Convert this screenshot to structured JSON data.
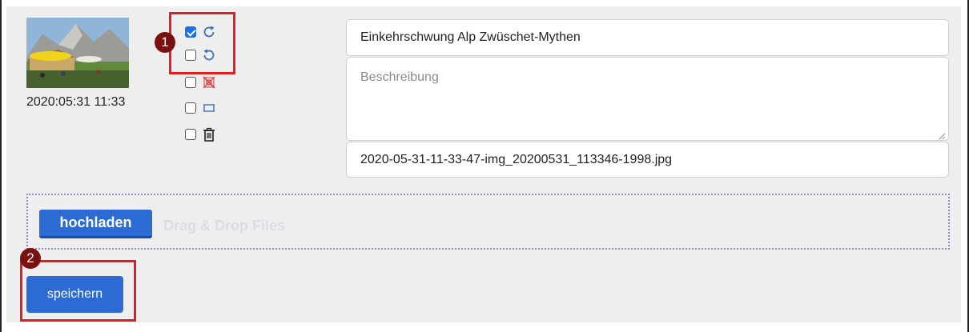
{
  "photo": {
    "date": "2020:05:31 11:33"
  },
  "options": [
    {
      "checked": true,
      "icon": "rotate-clockwise-icon"
    },
    {
      "checked": false,
      "icon": "rotate-counterclockwise-icon"
    },
    {
      "checked": false,
      "icon": "hide-image-icon"
    },
    {
      "checked": false,
      "icon": "panorama-icon"
    },
    {
      "checked": false,
      "icon": "trash-icon"
    }
  ],
  "annotations": {
    "badge1": "1",
    "badge2": "2",
    "highlight_color": "#e02020",
    "badge_color": "#7a1010"
  },
  "form": {
    "title_value": "Einkehrschwung Alp Zwüschet-Mythen",
    "description_placeholder": "Beschreibung",
    "filename_value": "2020-05-31-11-33-47-img_20200531_113346-1998.jpg"
  },
  "upload": {
    "button_label": "hochladen",
    "dropzone_hint": "Drag & Drop Files"
  },
  "save": {
    "button_label": "speichern"
  },
  "colors": {
    "button_blue": "#2b6bd3",
    "checkbox_blue": "#1a73e8",
    "panel_bg": "#eeeeee"
  }
}
